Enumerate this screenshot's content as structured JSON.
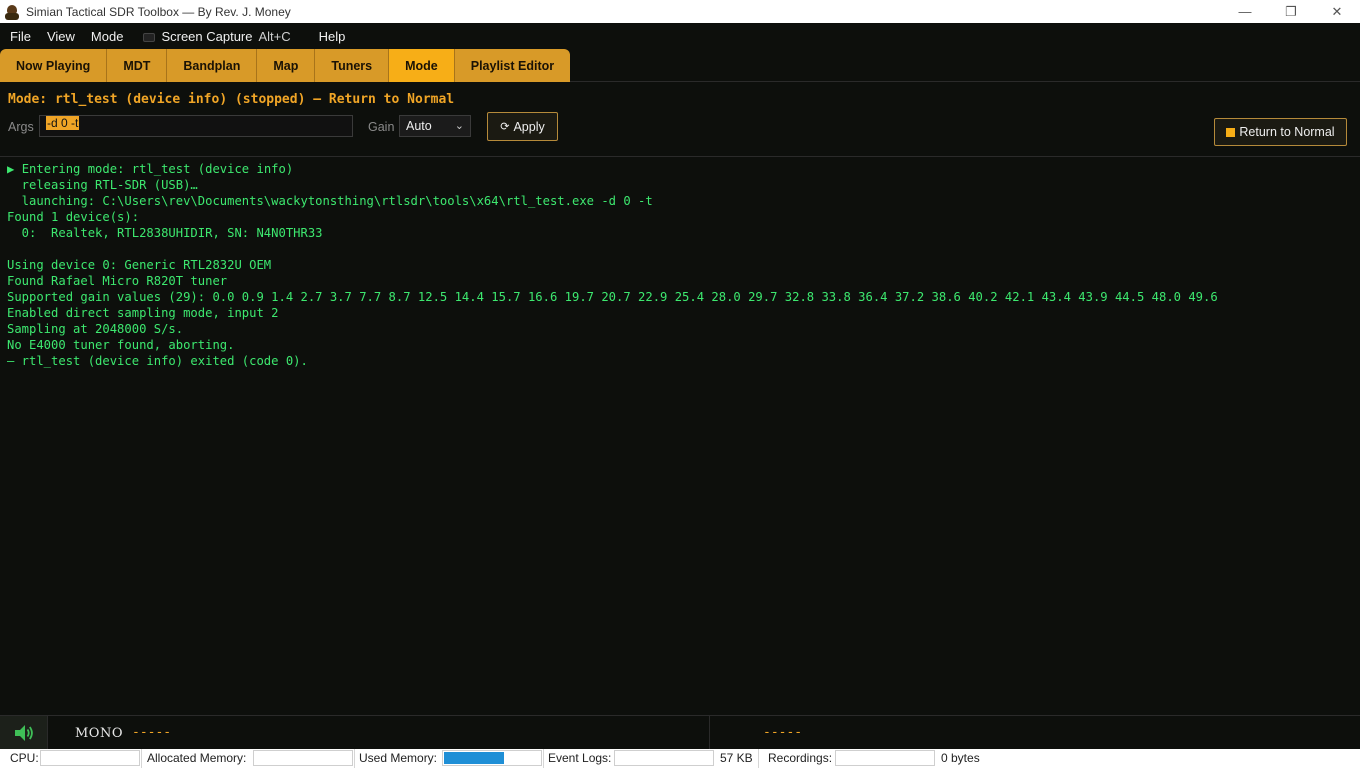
{
  "window": {
    "title": "Simian Tactical SDR Toolbox — By Rev. J. Money",
    "minimize": "—",
    "maximize": "❐",
    "close": "✕"
  },
  "menu": {
    "file": "File",
    "view": "View",
    "mode": "Mode",
    "screen_capture": "Screen Capture",
    "screen_capture_shortcut": "Alt+C",
    "help": "Help"
  },
  "tabs": [
    {
      "label": "Now Playing"
    },
    {
      "label": "MDT"
    },
    {
      "label": "Bandplan"
    },
    {
      "label": "Map"
    },
    {
      "label": "Tuners"
    },
    {
      "label": "Mode",
      "active": true
    },
    {
      "label": "Playlist Editor"
    }
  ],
  "mode_panel": {
    "title": "Mode: rtl_test (device info) (stopped) — Return to Normal",
    "args_label": "Args",
    "args_value": "-d 0 -t",
    "gain_label": "Gain",
    "gain_value": "Auto",
    "apply_icon": "⟳",
    "apply_label": "Apply",
    "return_label": "Return to Normal"
  },
  "console": {
    "lines": [
      "Entering mode: rtl_test (device info)",
      "  releasing RTL-SDR (USB)…",
      "  launching: C:\\Users\\rev\\Documents\\wackytonsthing\\rtlsdr\\tools\\x64\\rtl_test.exe -d 0 -t",
      "Found 1 device(s):",
      "  0:  Realtek, RTL2838UHIDIR, SN: N4N0THR33",
      "",
      "Using device 0: Generic RTL2832U OEM",
      "Found Rafael Micro R820T tuner",
      "Supported gain values (29): 0.0 0.9 1.4 2.7 3.7 7.7 8.7 12.5 14.4 15.7 16.6 19.7 20.7 22.9 25.4 28.0 29.7 32.8 33.8 36.4 37.2 38.6 40.2 42.1 43.4 43.9 44.5 48.0 49.6",
      "Enabled direct sampling mode, input 2",
      "Sampling at 2048000 S/s.",
      "No E4000 tuner found, aborting.",
      "— rtl_test (device info) exited (code 0)."
    ],
    "play_marker": "▶ "
  },
  "audio": {
    "channel_mode": "MONO",
    "left_readout": "-----",
    "right_readout": "-----"
  },
  "status": {
    "cpu_label": "CPU:",
    "allocated_label": "Allocated Memory:",
    "used_label": "Used Memory:",
    "used_fraction": 0.62,
    "event_logs_label": "Event Logs:",
    "event_logs_size": "57 KB",
    "recordings_label": "Recordings:",
    "recordings_size": "0 bytes"
  },
  "colors": {
    "tab_accent": "#d89a28",
    "tab_active": "#f7ae17",
    "console_text": "#3de86f",
    "mode_title": "#f0a526"
  }
}
